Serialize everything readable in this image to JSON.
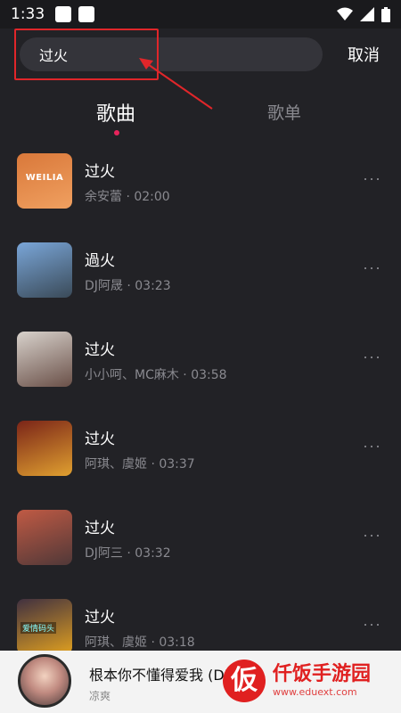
{
  "status_bar": {
    "time": "1:33"
  },
  "search": {
    "query": "过火",
    "cancel_label": "取消"
  },
  "tabs": [
    {
      "label": "歌曲",
      "active": true
    },
    {
      "label": "歌单",
      "active": false
    }
  ],
  "songs": [
    {
      "title": "过火",
      "meta": "余安蕾 · 02:00",
      "cover_text": "WEILIA",
      "cover_colors": [
        "#d9783a",
        "#f0a060"
      ]
    },
    {
      "title": "過火",
      "meta": "DJ阿晟 · 03:23",
      "cover_colors": [
        "#7aa6d8",
        "#3a4a58"
      ]
    },
    {
      "title": "过火",
      "meta": "小小呵、MC麻木 · 03:58",
      "cover_colors": [
        "#d8d2cc",
        "#6a5048"
      ]
    },
    {
      "title": "过火",
      "meta": "阿琪、虞姬 · 03:37",
      "cover_colors": [
        "#7a2418",
        "#e0a030"
      ]
    },
    {
      "title": "过火",
      "meta": "DJ阿三 · 03:32",
      "cover_colors": [
        "#c05a44",
        "#503838"
      ]
    },
    {
      "title": "过火",
      "meta": "阿琪、虞姬 · 03:18",
      "cover_text": "爱情码头",
      "cover_colors": [
        "#403040",
        "#e0a020"
      ]
    }
  ],
  "now_playing": {
    "title": "根本你不懂得爱我 (DJ...",
    "artist": "凉爽"
  },
  "watermark": {
    "logo": "仮",
    "brand": "仟饭手游园",
    "url": "www.eduext.com"
  },
  "colors": {
    "accent": "#e8245c",
    "highlight": "#e0262a",
    "background": "#222226"
  }
}
